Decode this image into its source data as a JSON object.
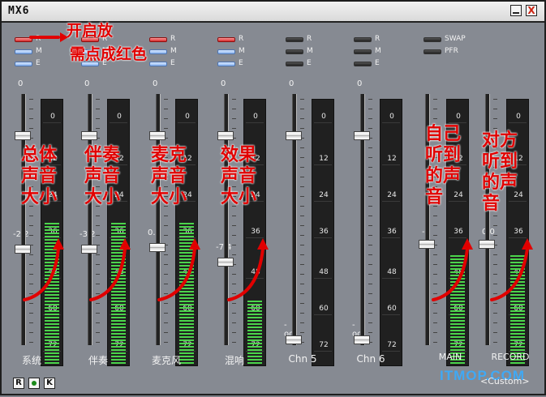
{
  "window": {
    "title": "MX6",
    "min_label": "",
    "close_label": "X"
  },
  "channels": [
    {
      "name": "系统",
      "fader_value": "0",
      "fader_value2": "-2.2",
      "sel": [
        "R",
        "M",
        "E"
      ],
      "red": true,
      "meter_level": 0.55
    },
    {
      "name": "伴奏",
      "fader_value": "0",
      "fader_value2": "-3.2",
      "sel": [
        "R",
        "M",
        "E"
      ],
      "red": true,
      "meter_level": 0.55
    },
    {
      "name": "麦克风",
      "fader_value": "0",
      "fader_value2": "0.0",
      "sel": [
        "R",
        "M",
        "E"
      ],
      "red": true,
      "meter_level": 0.55
    },
    {
      "name": "混响",
      "fader_value": "0",
      "fader_value2": "-7.4",
      "sel": [
        "R",
        "M",
        "E"
      ],
      "red": true,
      "meter_level": 0.25
    },
    {
      "name": "Chn 5",
      "fader_value": "0",
      "fader_value2": "-oo",
      "sel": [
        "R",
        "M",
        "E"
      ],
      "red": false,
      "meter_level": 0
    },
    {
      "name": "Chn 6",
      "fader_value": "0",
      "fader_value2": "-oo",
      "sel": [
        "R",
        "M",
        "E"
      ],
      "red": false,
      "meter_level": 0
    }
  ],
  "outputs": [
    {
      "name": "MAIN",
      "fader_value": "-0",
      "meter_level": 0.42
    },
    {
      "name": "RECORD",
      "fader_value": "0.0",
      "meter_level": 0.42
    }
  ],
  "output_sel": [
    "SWAP",
    "PFR"
  ],
  "meter_scale": [
    "0",
    "12",
    "24",
    "36",
    "48",
    "60",
    "72"
  ],
  "bottom": {
    "r_label": "R",
    "k_label": "K",
    "preset": "<Custom>"
  },
  "notes": {
    "top1": "开启放",
    "top2": "需点成红色",
    "c1": "总体\n声音\n大小",
    "c2": "伴奏\n声音\n大小",
    "c3": "麦克\n声音\n大小",
    "c4": "效果\n声音\n大小",
    "c5": "自己\n听到\n的声\n音",
    "c6": "对方\n听到\n的声\n音"
  },
  "watermark": "ITMOP.COM"
}
